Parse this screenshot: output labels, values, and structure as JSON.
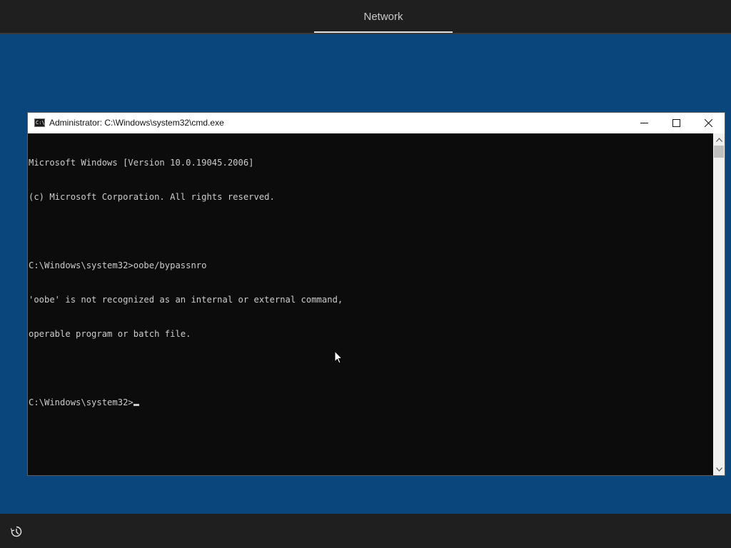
{
  "setup": {
    "tab_label": "Network"
  },
  "cmd": {
    "title": "Administrator: C:\\Windows\\system32\\cmd.exe",
    "icon_text": "C:\\",
    "console_lines": [
      "Microsoft Windows [Version 10.0.19045.2006]",
      "(c) Microsoft Corporation. All rights reserved.",
      "",
      "C:\\Windows\\system32>oobe/bypassnro",
      "'oobe' is not recognized as an internal or external command,",
      "operable program or batch file.",
      "",
      "C:\\Windows\\system32>"
    ]
  },
  "colors": {
    "background": "#0a467b",
    "bars": "#1f1f1f",
    "console_bg": "#0c0c0c",
    "console_text": "#cccccc"
  },
  "icons": {
    "accessibility": "ease-of-access-icon",
    "minimize": "minimize-icon",
    "maximize": "maximize-icon",
    "close": "close-icon"
  }
}
